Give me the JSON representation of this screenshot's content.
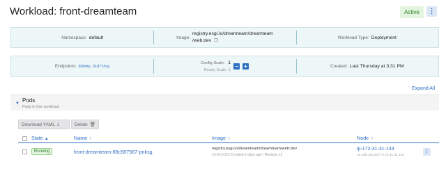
{
  "header": {
    "title": "Workload: front-dreamteam",
    "status": "Active",
    "menu_icon": "kebab-icon"
  },
  "info1": {
    "namespace_label": "Namespace:",
    "namespace_value": "default",
    "image_label": "Image:",
    "image_value_line1": "registry.esgi.io/dreamteam/dreamteam",
    "image_value_line2": "/web:dev",
    "workload_type_label": "Workload Type:",
    "workload_type_value": "Deployment"
  },
  "info2": {
    "endpoints_label": "Endpoints:",
    "endpoints_value": "80/http, 31877/tcp",
    "config_scale_label": "Config Scale:",
    "config_scale_value": "1",
    "ready_scale_label": "Ready Scale:",
    "ready_scale_value": "1",
    "decrement": "−",
    "increment": "+",
    "created_label": "Created:",
    "created_value": "Last Thursday at 3:31 PM"
  },
  "expand_all": "Expand All",
  "pods": {
    "title": "Pods",
    "subtitle": "Pods in this workload",
    "download_label": "Download YAML",
    "delete_label": "Delete",
    "columns": {
      "state": "State",
      "name": "Name",
      "image": "Image",
      "node": "Node"
    },
    "rows": [
      {
        "state": "Running",
        "name": "front-dreamteam-88c587567-pnksg",
        "image": "registry.esgi.io/dreamteam/dreamteam/web:dev",
        "image_sub": "10.42.0.20 / Created 2 days ago / Restarts 12",
        "node": "ip-172-31-31-143",
        "node_sub": "18.185.164.227 / 172.31.31.143"
      }
    ]
  }
}
